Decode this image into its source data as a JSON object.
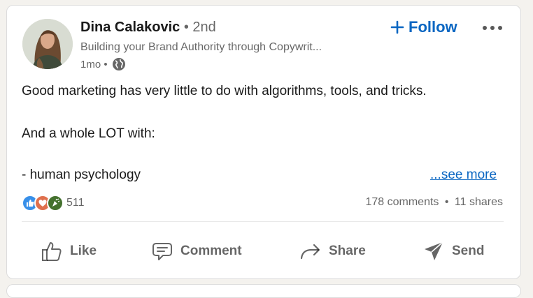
{
  "author": {
    "name": "Dina Calakovic",
    "degree": "• 2nd",
    "headline": "Building your Brand Authority through Copywrit...",
    "time": "1mo •",
    "avatar_icon": "profile-photo"
  },
  "follow_label": "Follow",
  "post": {
    "lines": [
      "Good marketing has very little to do with algorithms, tools, and tricks.",
      "And a whole LOT with:",
      "- human psychology"
    ],
    "see_more": "...see more"
  },
  "reactions": {
    "icons": [
      "like-icon",
      "love-icon",
      "celebrate-icon"
    ],
    "count": "511"
  },
  "social": {
    "comments": "178 comments",
    "separator": "•",
    "shares": "11 shares"
  },
  "actions": {
    "like": "Like",
    "comment": "Comment",
    "share": "Share",
    "send": "Send"
  },
  "colors": {
    "accent": "#0a66c2",
    "like_blue": "#378fe9",
    "love_red": "#df704d",
    "celebrate_green": "#44712e"
  }
}
